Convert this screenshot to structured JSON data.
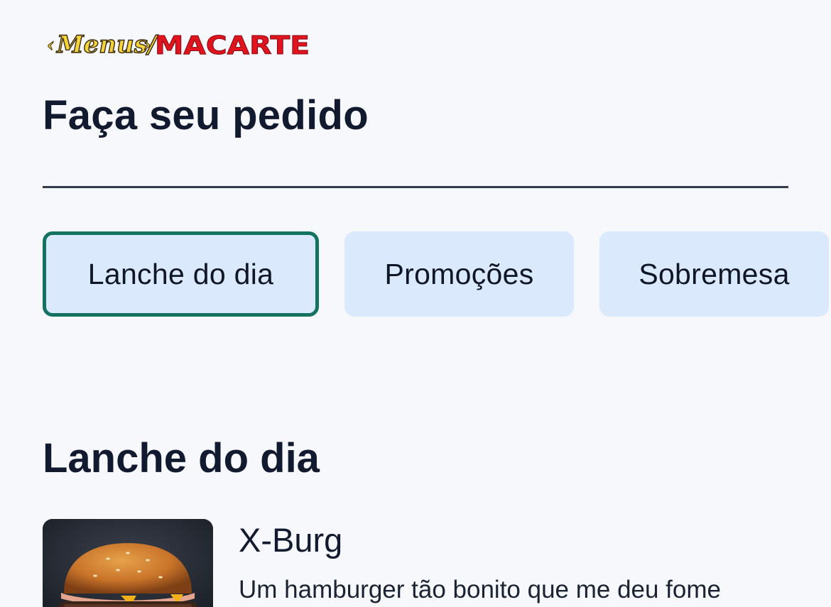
{
  "brand": {
    "logo_text_left": "Menus/",
    "logo_text_right": "MACARTE"
  },
  "header": {
    "title": "Faça seu pedido"
  },
  "tabs": [
    {
      "label": "Lanche do dia",
      "active": true
    },
    {
      "label": "Promoções",
      "active": false
    },
    {
      "label": "Sobremesa",
      "active": false
    }
  ],
  "section": {
    "title": "Lanche do dia"
  },
  "products": [
    {
      "name": "X-Burg",
      "description": "Um hamburger tão bonito que me deu fome",
      "image_icon": "burger-photo"
    }
  ],
  "colors": {
    "background": "#f7f8fc",
    "tab_bg": "#dbe9fc",
    "tab_active_border": "#137360",
    "text": "#111a2e",
    "logo_red": "#e0141e",
    "logo_yellow": "#f2d33a"
  }
}
